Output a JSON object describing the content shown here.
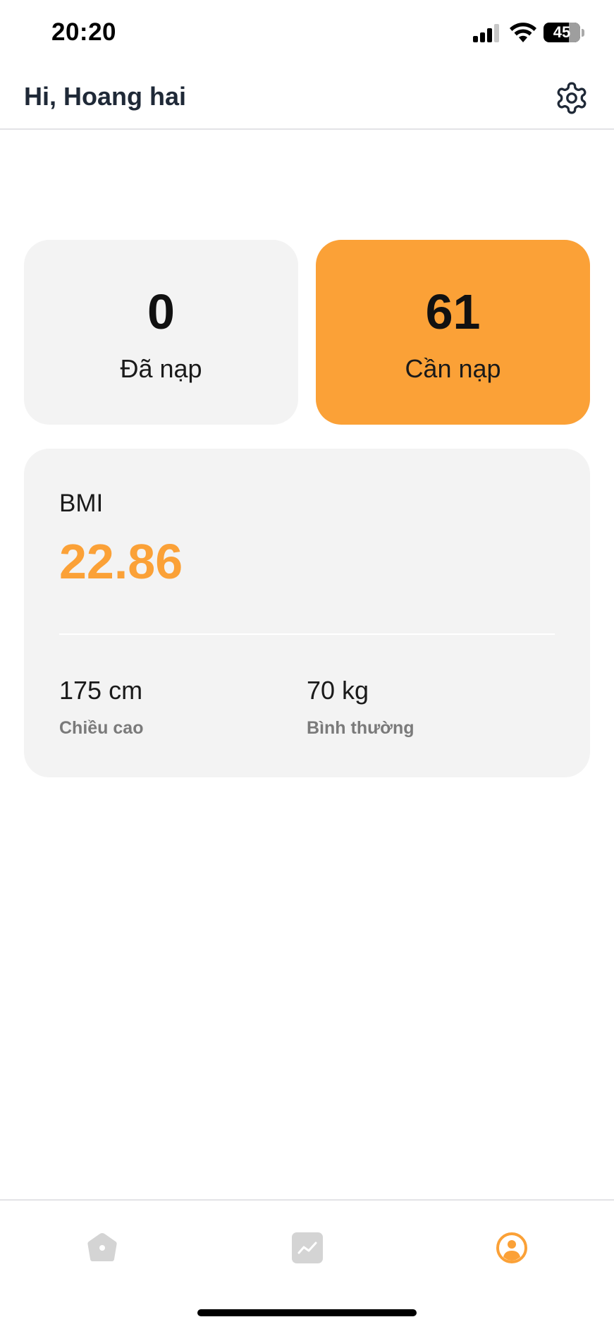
{
  "status_bar": {
    "time": "20:20",
    "battery": "45"
  },
  "header": {
    "greeting": "Hi, Hoang hai",
    "settings_icon": "gear-icon"
  },
  "stats": {
    "loaded": {
      "value": "0",
      "label": "Đã nạp"
    },
    "needed": {
      "value": "61",
      "label": "Cần nạp"
    }
  },
  "bmi": {
    "label": "BMI",
    "value": "22.86",
    "height_value": "175 cm",
    "height_label": "Chiều cao",
    "weight_value": "70 kg",
    "weight_label": "Bình thường"
  },
  "tab_bar": {
    "tabs": [
      {
        "icon": "home-icon",
        "active": false
      },
      {
        "icon": "chart-icon",
        "active": false
      },
      {
        "icon": "user-circle-icon",
        "active": true
      }
    ]
  },
  "colors": {
    "accent": "#fba137",
    "card_bg": "#f3f3f3",
    "inactive_tab": "#d4d4d4"
  }
}
